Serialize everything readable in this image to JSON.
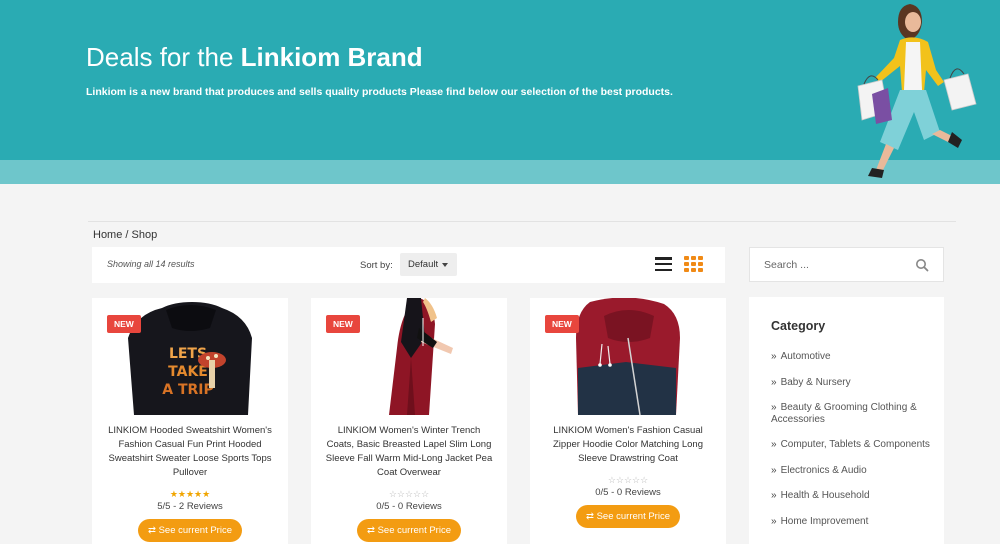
{
  "hero": {
    "title_prefix": "Deals for the ",
    "title_brand": "Linkiom Brand",
    "subtitle": "Linkiom is a new brand that produces and sells quality products Please find below our selection of the best products."
  },
  "breadcrumb": {
    "home": "Home",
    "separator": "/",
    "current": "Shop"
  },
  "toolbar": {
    "results_text": "Showing all 14 results",
    "sort_label": "Sort by:",
    "sort_value": "Default"
  },
  "products": [
    {
      "badge": "NEW",
      "title": "LINKIOM Hooded Sweatshirt Women's Fashion Casual Fun Print Hooded Sweatshirt Sweater Loose Sports Tops Pullover",
      "rating": 5,
      "reviews": "5/5 - 2 Reviews",
      "button": "⇄ See current Price"
    },
    {
      "badge": "NEW",
      "title": "LINKIOM Women's Winter Trench Coats, Basic Breasted Lapel Slim Long Sleeve Fall Warm Mid-Long Jacket Pea Coat Overwear",
      "rating": 0,
      "reviews": "0/5 - 0 Reviews",
      "button": "⇄ See current Price"
    },
    {
      "badge": "NEW",
      "title": "LINKIOM Women's Fashion Casual Zipper Hoodie Color Matching Long Sleeve Drawstring Coat",
      "rating": 0,
      "reviews": "0/5 - 0 Reviews",
      "button": "⇄ See current Price"
    }
  ],
  "sidebar": {
    "search_placeholder": "Search ...",
    "category_title": "Category",
    "categories": [
      "Automotive",
      "Baby & Nursery",
      "Beauty & Grooming Clothing & Accessories",
      "Computer, Tablets & Components",
      "Electronics & Audio",
      "Health & Household",
      "Home Improvement"
    ]
  },
  "colors": {
    "hero_bg": "#2aabb3",
    "accent_orange": "#f39c12",
    "badge_red": "#e8463d"
  }
}
